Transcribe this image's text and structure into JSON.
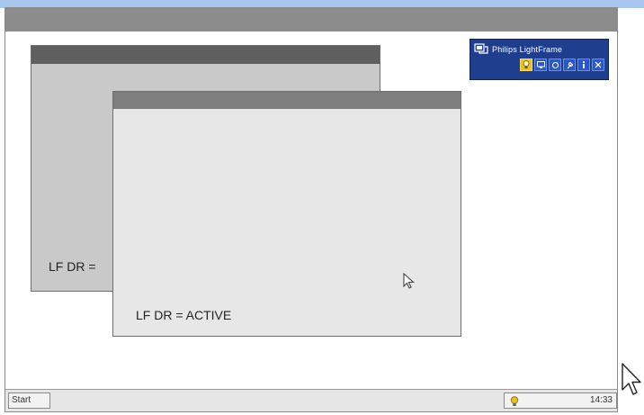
{
  "lightframe": {
    "title": "Philips LightFrame",
    "buttons": [
      "lightbulb",
      "monitor",
      "refresh",
      "tool",
      "info",
      "close"
    ]
  },
  "windows": {
    "back": {
      "status_text": "LF DR ="
    },
    "front": {
      "status_text": "LF DR = ACTIVE"
    }
  },
  "taskbar": {
    "start_label": "Start",
    "clock": "14:33",
    "tray_icon": "lightbulb-icon"
  },
  "colors": {
    "accent": "#a9c6ee",
    "widget_blue": "#1f3f8e",
    "active_yellow": "#e8c12a"
  }
}
